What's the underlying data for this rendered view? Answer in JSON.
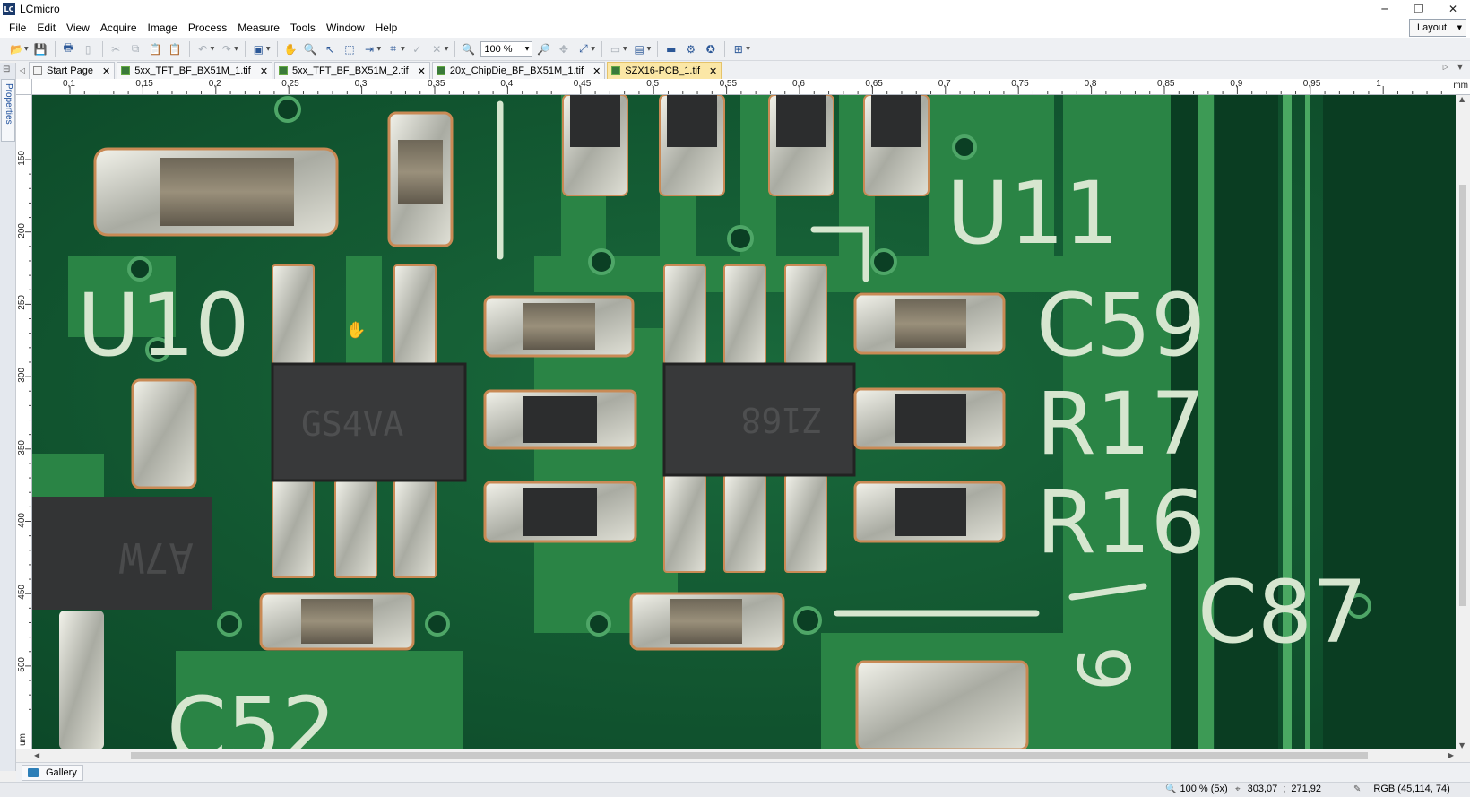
{
  "window": {
    "title": "LCmicro",
    "logo_text": "LC",
    "controls": {
      "minimize": "─",
      "restore": "❐",
      "close": "✕"
    }
  },
  "menu": {
    "items": [
      "File",
      "Edit",
      "View",
      "Acquire",
      "Image",
      "Process",
      "Measure",
      "Tools",
      "Window",
      "Help"
    ],
    "layout_label": "Layout"
  },
  "toolbar": {
    "zoom_value": "100 %",
    "icons": [
      "open-icon",
      "save-icon",
      "print-icon",
      "print-preview-icon",
      "cut-icon",
      "copy-icon",
      "paste-icon",
      "paste-special-icon",
      "undo-icon",
      "redo-icon",
      "snapshot-icon",
      "hand-pan-icon",
      "zoom-tool-icon",
      "pointer-icon",
      "rect-select-icon",
      "arrow-select-icon",
      "crop-icon",
      "apply-icon",
      "delete-icon",
      "zoom-out-icon",
      "zoom-in-icon",
      "zoom-fit-icon",
      "zoom-actual-icon",
      "annotation-icon",
      "measure-line-icon",
      "calibration-icon",
      "settings-icon",
      "overlay-icon"
    ]
  },
  "side_panel": {
    "label": "Properties"
  },
  "tabs": [
    {
      "label": "Start Page",
      "active": false,
      "kind": "page"
    },
    {
      "label": "5xx_TFT_BF_BX51M_1.tif",
      "active": false,
      "kind": "image"
    },
    {
      "label": "5xx_TFT_BF_BX51M_2.tif",
      "active": false,
      "kind": "image"
    },
    {
      "label": "20x_ChipDie_BF_BX51M_1.tif",
      "active": false,
      "kind": "image"
    },
    {
      "label": "SZX16-PCB_1.tif",
      "active": true,
      "kind": "image"
    }
  ],
  "tab_close": "✕",
  "ruler_top": {
    "unit": "mm",
    "labels": [
      "0,1",
      "0,15",
      "0,2",
      "0,25",
      "0,3",
      "0,35",
      "0,4",
      "0,45",
      "0,5",
      "0,55",
      "0,6",
      "0,65",
      "0,7",
      "0,75",
      "0,8",
      "0,85",
      "0,9",
      "0,95",
      "1"
    ]
  },
  "ruler_left": {
    "unit": "um",
    "labels": [
      "150",
      "200",
      "250",
      "300",
      "350",
      "400",
      "450",
      "500"
    ]
  },
  "image": {
    "silkscreen": [
      "U10",
      "U11",
      "C59",
      "R17",
      "R16",
      "C87",
      "C52",
      "6"
    ],
    "chip_marks": [
      "GS4VA",
      "Z168",
      "A7W"
    ],
    "colors": {
      "board": "#0f5a32",
      "trace": "#2c8a4a",
      "pad": "#c9c9bd",
      "chip": "#3a3b3c",
      "silk": "#d6e6cf"
    }
  },
  "gallery": {
    "label": "Gallery"
  },
  "status": {
    "zoom": "100 % (5x)",
    "coord_x": "303,07",
    "coord_y": "271,92",
    "pixel_value": "RGB (45,114, 74)"
  }
}
